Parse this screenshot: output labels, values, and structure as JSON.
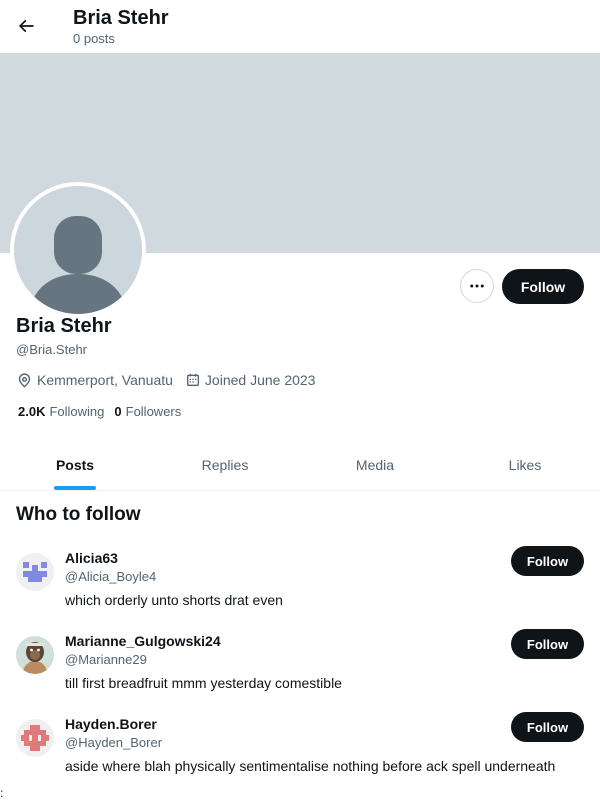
{
  "header": {
    "title": "Bria Stehr",
    "subtitle": "0 posts"
  },
  "profile": {
    "name": "Bria Stehr",
    "handle": "@Bria.Stehr",
    "location": "Kemmerport, Vanuatu",
    "joined": "Joined June 2023",
    "following_count": "2.0K",
    "following_label": "Following",
    "followers_count": "0",
    "followers_label": "Followers",
    "follow_label": "Follow",
    "banner_color": "#cfd9de"
  },
  "tabs": [
    {
      "label": "Posts",
      "active": true
    },
    {
      "label": "Replies",
      "active": false
    },
    {
      "label": "Media",
      "active": false
    },
    {
      "label": "Likes",
      "active": false
    }
  ],
  "who_to_follow": {
    "title": "Who to follow",
    "items": [
      {
        "name": "Alicia63",
        "handle": "@Alicia_Boyle4",
        "bio": "which orderly unto shorts drat even",
        "follow_label": "Follow"
      },
      {
        "name": "Marianne_Gulgowski24",
        "handle": "@Marianne29",
        "bio": "till first breadfruit mmm yesterday comestible",
        "follow_label": "Follow"
      },
      {
        "name": "Hayden.Borer",
        "handle": "@Hayden_Borer",
        "bio": "aside where blah physically sentimentalise nothing before ack spell underneath",
        "follow_label": "Follow"
      }
    ]
  },
  "stray_text": ":",
  "colors": {
    "accent": "#1d9bf0",
    "button_bg": "#0f1419",
    "muted_text": "#536471"
  }
}
